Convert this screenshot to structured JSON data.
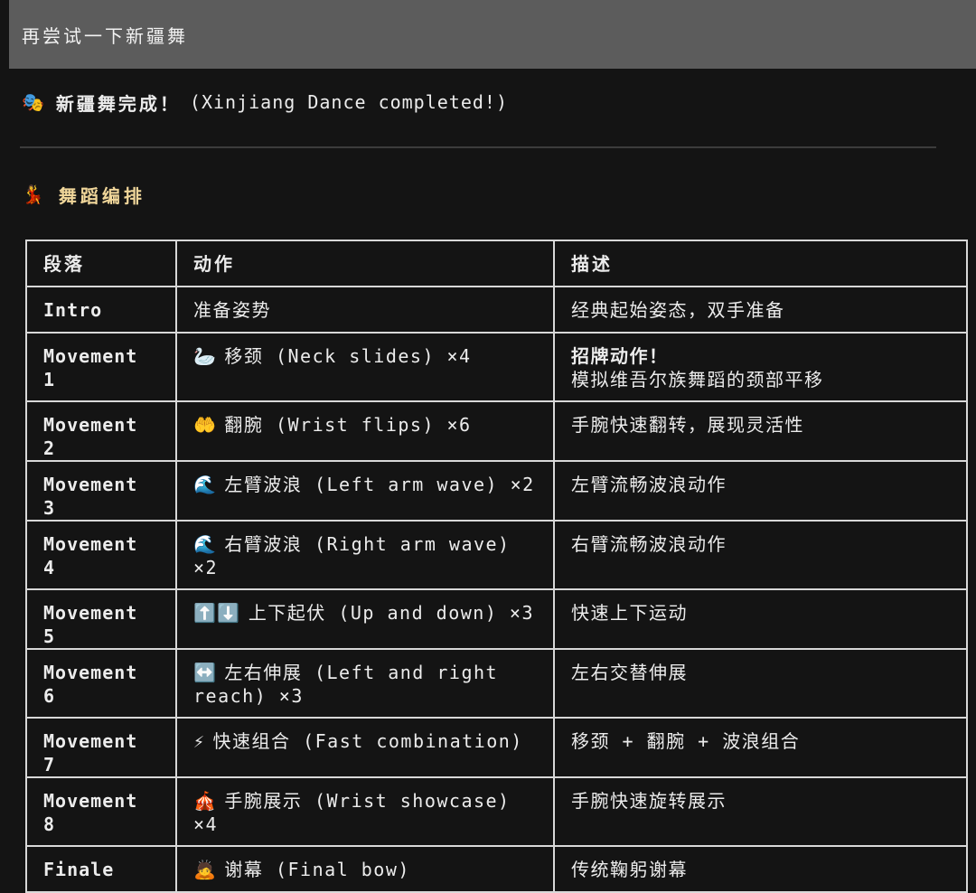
{
  "prompt": {
    "text": "再尝试一下新疆舞"
  },
  "status": {
    "icon": "🎭",
    "title_cn": "新疆舞完成！",
    "title_en": "(Xinjiang Dance completed!)"
  },
  "section": {
    "icon": "💃",
    "heading": "舞蹈编排"
  },
  "table": {
    "headers": [
      "段落",
      "动作",
      "描述"
    ],
    "rows": [
      {
        "segment": "Intro",
        "icon": "",
        "action": "准备姿势",
        "desc_strong": "",
        "desc": "经典起始姿态，双手准备"
      },
      {
        "segment": "Movement 1",
        "icon": "🦢",
        "action": "移颈 (Neck slides) ×4",
        "desc_strong": "招牌动作！",
        "desc": "模拟维吾尔族舞蹈的颈部平移"
      },
      {
        "segment": "Movement 2",
        "icon": "🤲",
        "action": "翻腕 (Wrist flips) ×6",
        "desc_strong": "",
        "desc": "手腕快速翻转，展现灵活性"
      },
      {
        "segment": "Movement 3",
        "icon": "🌊",
        "action": "左臂波浪 (Left arm wave) ×2",
        "desc_strong": "",
        "desc": "左臂流畅波浪动作"
      },
      {
        "segment": "Movement 4",
        "icon": "🌊",
        "action": "右臂波浪 (Right arm wave) ×2",
        "desc_strong": "",
        "desc": "右臂流畅波浪动作"
      },
      {
        "segment": "Movement 5",
        "icon": "⬆️⬇️",
        "action": "上下起伏 (Up and down) ×3",
        "desc_strong": "",
        "desc": "快速上下运动"
      },
      {
        "segment": "Movement 6",
        "icon": "↔️",
        "action": "左右伸展 (Left and right reach) ×3",
        "desc_strong": "",
        "desc": "左右交替伸展"
      },
      {
        "segment": "Movement 7",
        "icon": "⚡",
        "action": "快速组合 (Fast combination)",
        "desc_strong": "",
        "desc": "移颈 + 翻腕 + 波浪组合"
      },
      {
        "segment": "Movement 8",
        "icon": "🎪",
        "action": "手腕展示 (Wrist showcase) ×4",
        "desc_strong": "",
        "desc": "手腕快速旋转展示"
      },
      {
        "segment": "Finale",
        "icon": "🙇",
        "action": "谢幕 (Final bow)",
        "desc_strong": "",
        "desc": "传统鞠躬谢幕"
      }
    ]
  }
}
